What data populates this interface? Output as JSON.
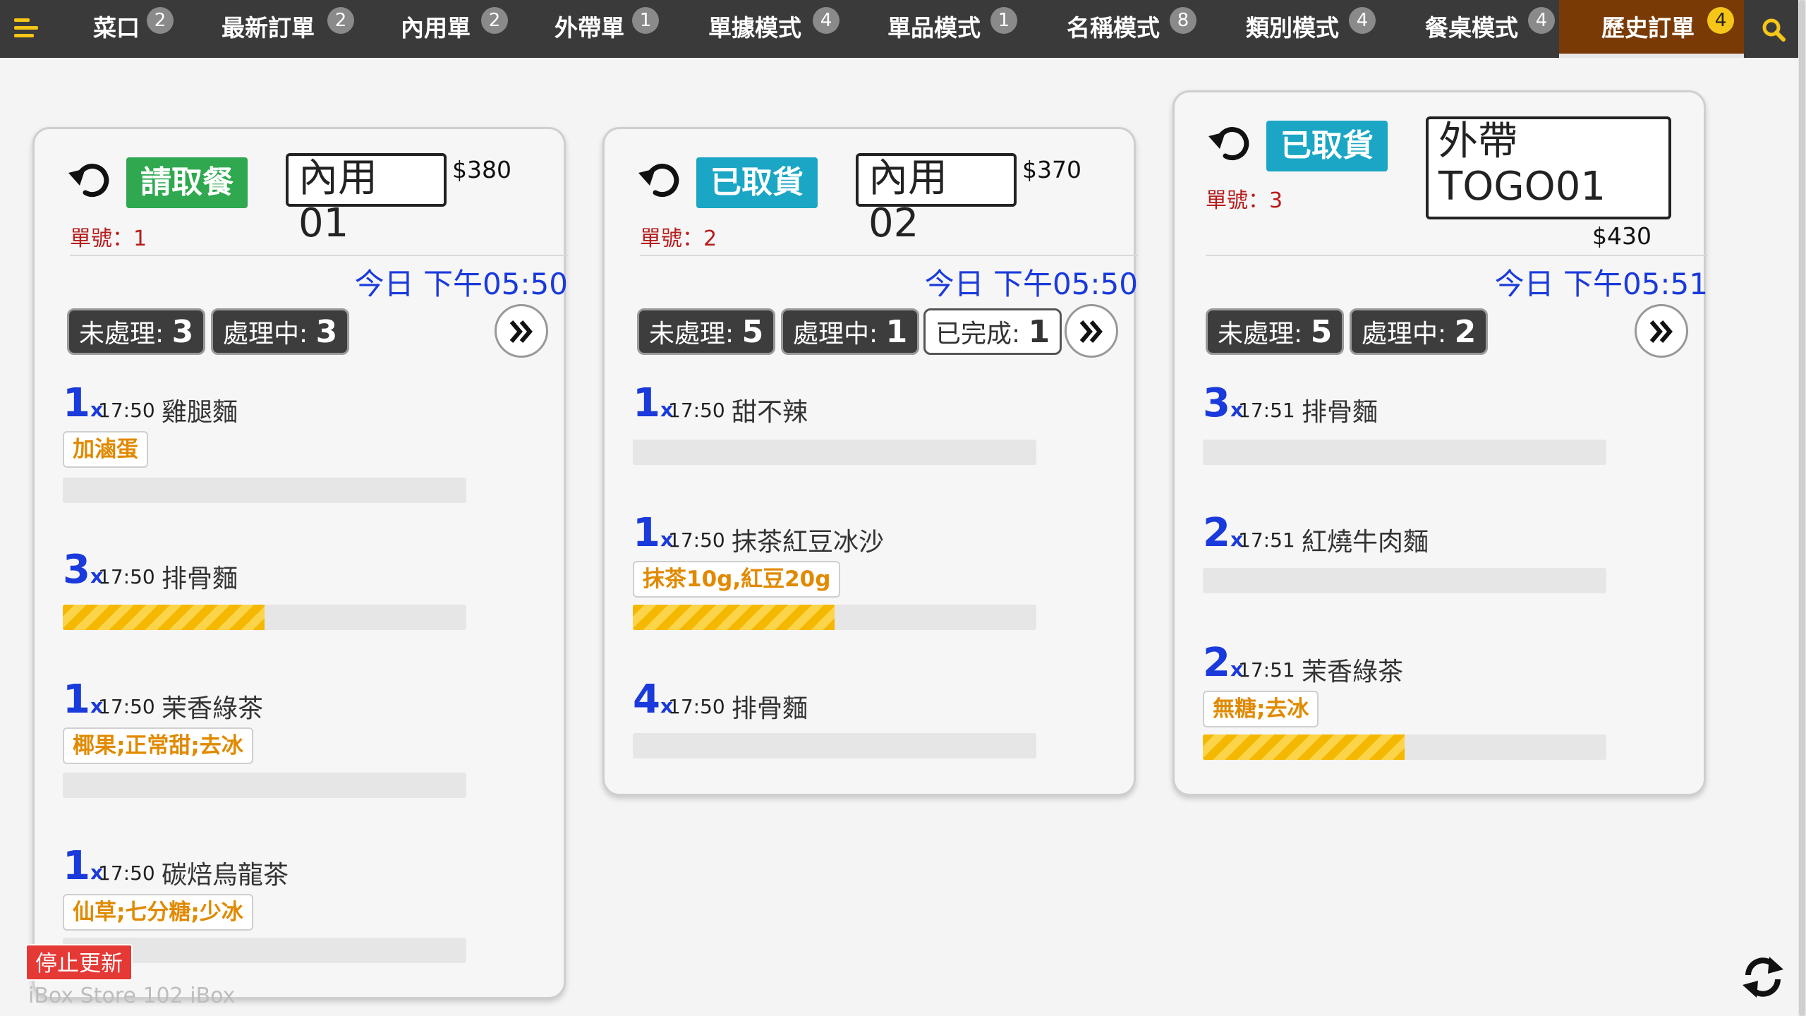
{
  "nav": {
    "tabs": [
      {
        "label": "菜口",
        "badge": "2"
      },
      {
        "label": "最新訂單",
        "badge": "2"
      },
      {
        "label": "內用單",
        "badge": "2"
      },
      {
        "label": "外帶單",
        "badge": "1"
      },
      {
        "label": "單據模式",
        "badge": "4"
      },
      {
        "label": "單品模式",
        "badge": "1"
      },
      {
        "label": "名稱模式",
        "badge": "8"
      },
      {
        "label": "類別模式",
        "badge": "4"
      },
      {
        "label": "餐桌模式",
        "badge": "4"
      },
      {
        "label": "歷史訂單",
        "badge": "4",
        "active": true
      }
    ]
  },
  "orders": [
    {
      "status": "請取餐",
      "status_color": "#2fa84f",
      "table": "內用 01",
      "price": "$380",
      "order_no": "單號：1",
      "time": "今日 下午05:50",
      "chips": [
        {
          "label": "未處理:",
          "count": "3"
        },
        {
          "label": "處理中:",
          "count": "3"
        }
      ],
      "items": [
        {
          "qty": "1",
          "time": "17:50",
          "name": "雞腿麵",
          "modifier": "加滷蛋",
          "progress": 0
        },
        {
          "qty": "3",
          "time": "17:50",
          "name": "排骨麵",
          "modifier": "",
          "progress": 0.5
        },
        {
          "qty": "1",
          "time": "17:50",
          "name": "茉香綠茶",
          "modifier": "椰果;正常甜;去冰",
          "progress": 0
        },
        {
          "qty": "1",
          "time": "17:50",
          "name": "碳焙烏龍茶",
          "modifier": "仙草;七分糖;少冰",
          "progress": 0
        }
      ]
    },
    {
      "status": "已取貨",
      "status_color": "#1aa6c4",
      "table": "內用 02",
      "price": "$370",
      "order_no": "單號：2",
      "time": "今日 下午05:50",
      "chips": [
        {
          "label": "未處理:",
          "count": "5"
        },
        {
          "label": "處理中:",
          "count": "1"
        },
        {
          "label": "已完成:",
          "count": "1"
        }
      ],
      "items": [
        {
          "qty": "1",
          "time": "17:50",
          "name": "甜不辣",
          "modifier": "",
          "progress": 0
        },
        {
          "qty": "1",
          "time": "17:50",
          "name": "抹茶紅豆冰沙",
          "modifier": "抹茶10g,紅豆20g",
          "progress": 0.5
        },
        {
          "qty": "4",
          "time": "17:50",
          "name": "排骨麵",
          "modifier": "",
          "progress": 0
        }
      ]
    },
    {
      "status": "已取貨",
      "status_color": "#1aa6c4",
      "table": "外帶 TOGO01",
      "table_line1": "外帶",
      "table_line2": "TOGO01",
      "price": "$430",
      "order_no": "單號：3",
      "time": "今日 下午05:51",
      "chips": [
        {
          "label": "未處理:",
          "count": "5"
        },
        {
          "label": "處理中:",
          "count": "2"
        }
      ],
      "items": [
        {
          "qty": "3",
          "time": "17:51",
          "name": "排骨麵",
          "modifier": "",
          "progress": 0
        },
        {
          "qty": "2",
          "time": "17:51",
          "name": "紅燒牛肉麵",
          "modifier": "",
          "progress": 0
        },
        {
          "qty": "2",
          "time": "17:51",
          "name": "茉香綠茶",
          "modifier": "無糖;去冰",
          "progress": 0.5
        }
      ]
    }
  ],
  "footer": {
    "stop_label": "停止更新",
    "store_text": "iBox Store 102 iBox"
  },
  "colors": {
    "nav_bg": "#3a3a3a",
    "active_tab_bg": "#7a3a06",
    "accent_yellow": "#f5c518",
    "time_blue": "#1a3adb",
    "order_no_red": "#b71c1c",
    "modifier_orange": "#e08a00",
    "stop_red": "#e53935"
  },
  "icons": [
    "menu-icon",
    "search-icon",
    "undo-icon",
    "double-chevron-right-icon",
    "refresh-icon"
  ]
}
